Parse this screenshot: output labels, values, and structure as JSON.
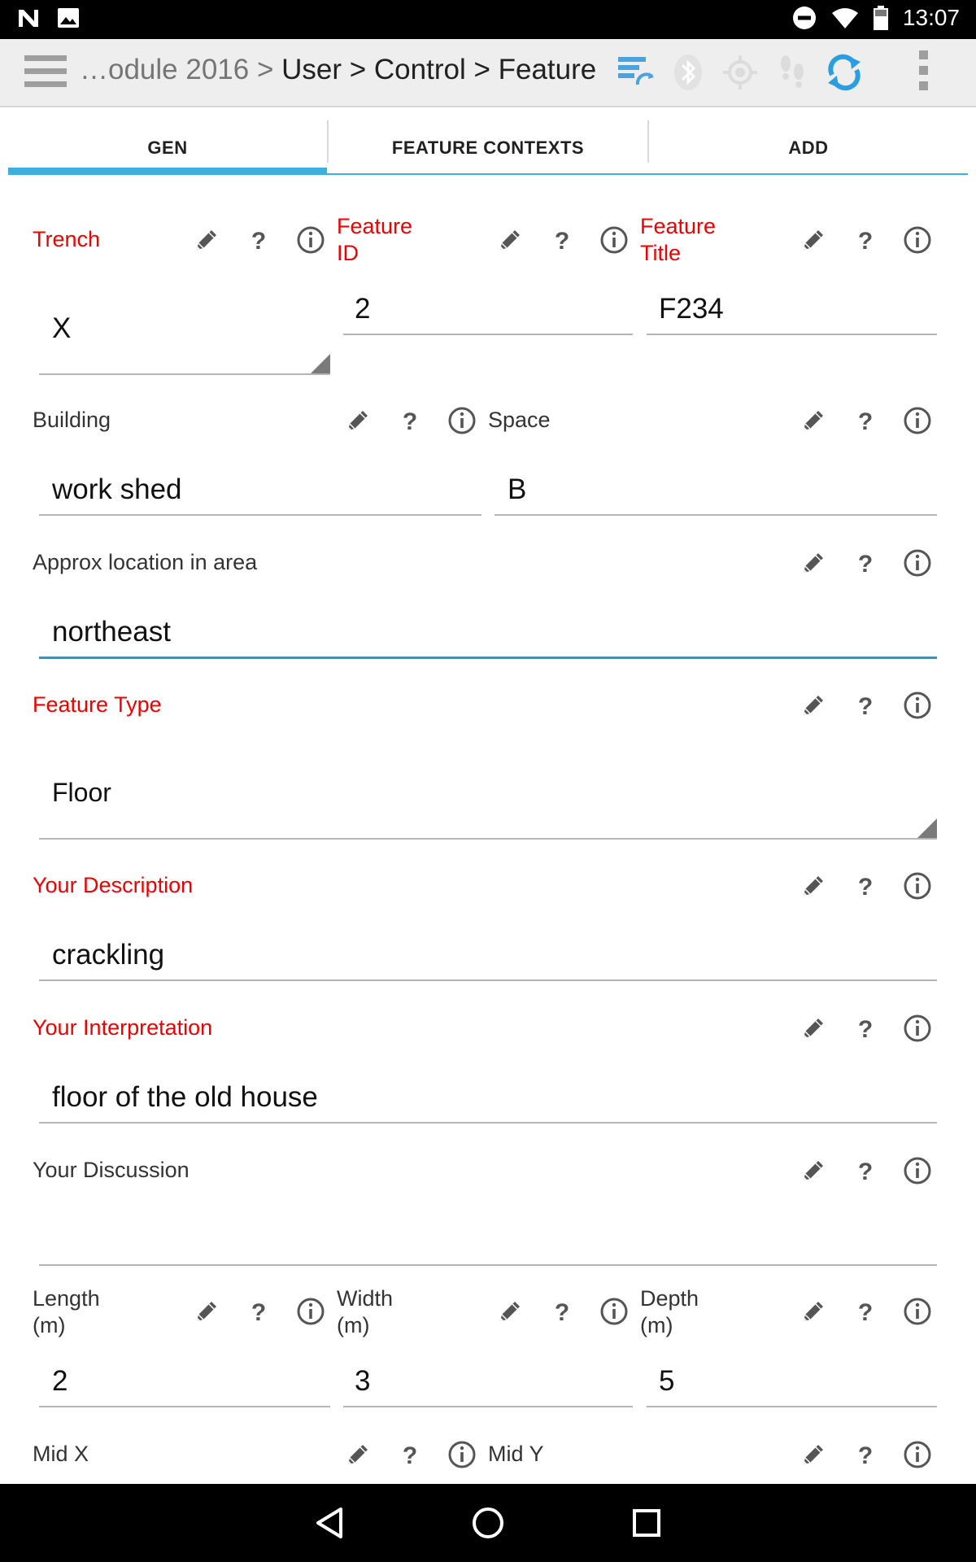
{
  "status_bar": {
    "time": "13:07"
  },
  "app_bar": {
    "title_truncated": "…odule 2016 > ",
    "title": "User > Control > Feature"
  },
  "tabs": [
    {
      "label": "GEN",
      "active": true
    },
    {
      "label": "FEATURE CONTEXTS",
      "active": false
    },
    {
      "label": "ADD",
      "active": false
    }
  ],
  "form": {
    "trench": {
      "label": "Trench",
      "value": "X"
    },
    "feature_id": {
      "label": "Feature\nID",
      "value": "2"
    },
    "feature_title": {
      "label": "Feature\nTitle",
      "value": "F234"
    },
    "building": {
      "label": "Building",
      "value": "work shed"
    },
    "space": {
      "label": "Space",
      "value": "B"
    },
    "approx_location": {
      "label": "Approx location in area",
      "value": "northeast"
    },
    "feature_type": {
      "label": "Feature Type",
      "value": "Floor"
    },
    "description": {
      "label": "Your Description",
      "value": "crackling"
    },
    "interpretation": {
      "label": "Your Interpretation",
      "value": "floor of the old house"
    },
    "discussion": {
      "label": "Your Discussion",
      "value": ""
    },
    "length": {
      "label": "Length\n(m)",
      "value": "2"
    },
    "width": {
      "label": "Width\n(m)",
      "value": "3"
    },
    "depth": {
      "label": "Depth\n(m)",
      "value": "5"
    },
    "mid_x": {
      "label": "Mid X"
    },
    "mid_y": {
      "label": "Mid Y"
    }
  },
  "colors": {
    "required_label": "#f00000",
    "accent": "#39b0e0",
    "icon": "#555555"
  },
  "icons": [
    "pencil-icon",
    "help-icon",
    "info-icon"
  ]
}
